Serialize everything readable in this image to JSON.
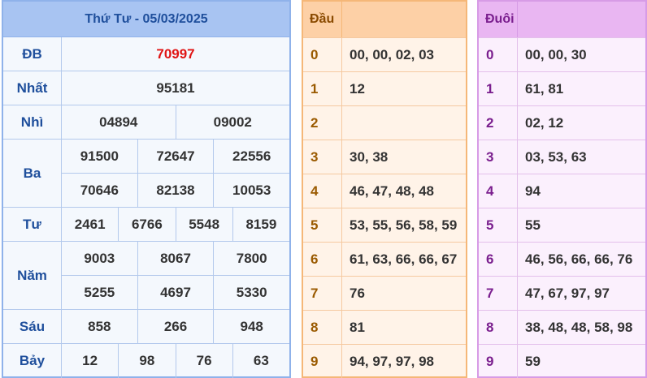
{
  "results": {
    "title": "Thứ Tư - 05/03/2025",
    "prizes": [
      {
        "label": "ĐB",
        "lines": [
          [
            "70997"
          ]
        ],
        "highlight": true
      },
      {
        "label": "Nhất",
        "lines": [
          [
            "95181"
          ]
        ]
      },
      {
        "label": "Nhì",
        "lines": [
          [
            "04894",
            "09002"
          ]
        ]
      },
      {
        "label": "Ba",
        "lines": [
          [
            "91500",
            "72647",
            "22556"
          ],
          [
            "70646",
            "82138",
            "10053"
          ]
        ]
      },
      {
        "label": "Tư",
        "lines": [
          [
            "2461",
            "6766",
            "5548",
            "8159"
          ]
        ]
      },
      {
        "label": "Năm",
        "lines": [
          [
            "9003",
            "8067",
            "7800"
          ],
          [
            "5255",
            "4697",
            "5330"
          ]
        ]
      },
      {
        "label": "Sáu",
        "lines": [
          [
            "858",
            "266",
            "948"
          ]
        ]
      },
      {
        "label": "Bảy",
        "lines": [
          [
            "12",
            "98",
            "76",
            "63"
          ]
        ]
      }
    ]
  },
  "dau": {
    "header": "Đầu",
    "rows": [
      {
        "digit": "0",
        "values": "00, 00, 02, 03"
      },
      {
        "digit": "1",
        "values": "12"
      },
      {
        "digit": "2",
        "values": ""
      },
      {
        "digit": "3",
        "values": "30, 38"
      },
      {
        "digit": "4",
        "values": "46, 47, 48, 48"
      },
      {
        "digit": "5",
        "values": "53, 55, 56, 58, 59"
      },
      {
        "digit": "6",
        "values": "61, 63, 66, 66, 67"
      },
      {
        "digit": "7",
        "values": "76"
      },
      {
        "digit": "8",
        "values": "81"
      },
      {
        "digit": "9",
        "values": "94, 97, 97, 98"
      }
    ]
  },
  "duoi": {
    "header": "Đuôi",
    "rows": [
      {
        "digit": "0",
        "values": "00, 00, 30"
      },
      {
        "digit": "1",
        "values": "61, 81"
      },
      {
        "digit": "2",
        "values": "02, 12"
      },
      {
        "digit": "3",
        "values": "03, 53, 63"
      },
      {
        "digit": "4",
        "values": "94"
      },
      {
        "digit": "5",
        "values": "55"
      },
      {
        "digit": "6",
        "values": "46, 56, 66, 66, 76"
      },
      {
        "digit": "7",
        "values": "47, 67, 97, 97"
      },
      {
        "digit": "8",
        "values": "38, 48, 48, 58, 98"
      },
      {
        "digit": "9",
        "values": "59"
      }
    ]
  },
  "colors": {
    "special_prize": "#e01414",
    "results_accent": "#1f4f9c",
    "dau_accent": "#f5b778",
    "duoi_accent": "#d79be6"
  }
}
